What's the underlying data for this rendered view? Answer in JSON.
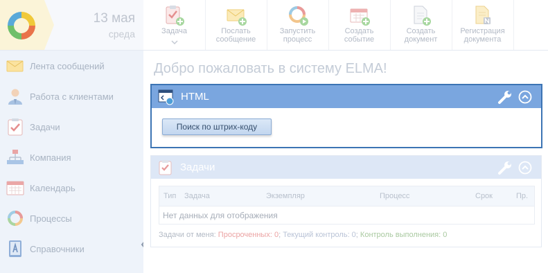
{
  "header": {
    "date_day": "13 мая",
    "date_weekday": "среда",
    "toolbar": [
      {
        "line1": "Задача",
        "line2": "",
        "icon": "task-add-icon"
      },
      {
        "line1": "Послать",
        "line2": "сообщение",
        "icon": "message-add-icon"
      },
      {
        "line1": "Запустить",
        "line2": "процесс",
        "icon": "process-start-icon"
      },
      {
        "line1": "Создать",
        "line2": "событие",
        "icon": "calendar-add-icon"
      },
      {
        "line1": "Создать",
        "line2": "документ",
        "icon": "document-add-icon"
      },
      {
        "line1": "Регистрация",
        "line2": "документа",
        "icon": "document-register-icon"
      }
    ]
  },
  "sidebar": {
    "items": [
      {
        "label": "Лента сообщений",
        "icon": "message-feed-icon"
      },
      {
        "label": "Работа с клиентами",
        "icon": "clients-icon"
      },
      {
        "label": "Задачи",
        "icon": "tasks-icon"
      },
      {
        "label": "Компания",
        "icon": "company-icon"
      },
      {
        "label": "Календарь",
        "icon": "calendar-icon"
      },
      {
        "label": "Процессы",
        "icon": "processes-icon"
      },
      {
        "label": "Справочники",
        "icon": "catalogs-icon"
      }
    ]
  },
  "main": {
    "title": "Добро пожаловать в систему ELMA!",
    "html_portlet": {
      "title": "HTML",
      "button_label": "Поиск по штрих-коду"
    },
    "tasks_portlet": {
      "title": "Задачи",
      "columns": [
        "Тип",
        "Задача",
        "Экземпляр",
        "Процесс",
        "Срок",
        "Пр."
      ],
      "empty_text": "Нет данных для отображения",
      "footer": {
        "prefix": "Задачи от меня: ",
        "overdue": "Просроченных: 0",
        "current": "Текущий контроль: 0",
        "control": "Контроль выполнения: 0",
        "separator": "; "
      }
    }
  },
  "colors": {
    "accent": "#3c74b4",
    "portlet_header": "#7aa6df",
    "sidebar_bg": "#eef3fa"
  }
}
